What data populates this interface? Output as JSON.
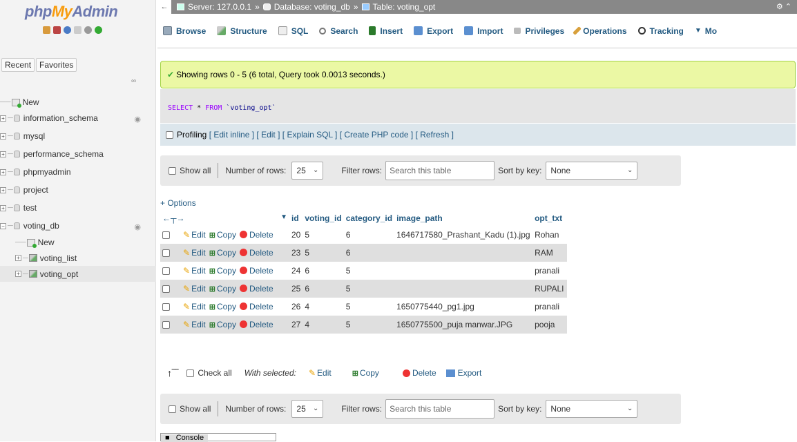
{
  "sidebar": {
    "logo_php": "php",
    "logo_my": "My",
    "logo_admin": "Admin",
    "tab_recent": "Recent",
    "tab_favorites": "Favorites",
    "tree": [
      {
        "label": "New"
      },
      {
        "label": "information_schema"
      },
      {
        "label": "mysql"
      },
      {
        "label": "performance_schema"
      },
      {
        "label": "phpmyadmin"
      },
      {
        "label": "project"
      },
      {
        "label": "test"
      },
      {
        "label": "voting_db"
      },
      {
        "label": "New"
      },
      {
        "label": "voting_list"
      },
      {
        "label": "voting_opt"
      }
    ]
  },
  "topbar": {
    "server": "Server: 127.0.0.1",
    "database": "Database: voting_db",
    "table": "Table: voting_opt",
    "sep": "»"
  },
  "tabs": [
    {
      "label": "Browse"
    },
    {
      "label": "Structure"
    },
    {
      "label": "SQL"
    },
    {
      "label": "Search"
    },
    {
      "label": "Insert"
    },
    {
      "label": "Export"
    },
    {
      "label": "Import"
    },
    {
      "label": "Privileges"
    },
    {
      "label": "Operations"
    },
    {
      "label": "Tracking"
    },
    {
      "label": "Mo"
    }
  ],
  "success_message": "Showing rows 0 - 5 (6 total, Query took 0.0013 seconds.)",
  "sql": {
    "kw1": "SELECT",
    "star": " * ",
    "kw2": "FROM",
    "table": " `voting_opt`"
  },
  "profiling": {
    "label": "Profiling",
    "links": [
      "Edit inline",
      "Edit",
      "Explain SQL",
      "Create PHP code",
      "Refresh"
    ]
  },
  "nav": {
    "show_all": "Show all",
    "rows_label": "Number of rows:",
    "rows_value": "25",
    "filter_label": "Filter rows:",
    "filter_placeholder": "Search this table",
    "sort_label": "Sort by key:",
    "sort_value": "None"
  },
  "options_link": "+ Options",
  "grid": {
    "headers": [
      "id",
      "voting_id",
      "category_id",
      "image_path",
      "opt_txt"
    ],
    "action_labels": {
      "edit": "Edit",
      "copy": "Copy",
      "delete": "Delete"
    },
    "rows": [
      {
        "id": "20",
        "voting_id": "5",
        "category_id": "6",
        "image_path": "1646717580_Prashant_Kadu (1).jpg",
        "opt_txt": "Rohan"
      },
      {
        "id": "23",
        "voting_id": "5",
        "category_id": "6",
        "image_path": "",
        "opt_txt": "RAM"
      },
      {
        "id": "24",
        "voting_id": "6",
        "category_id": "5",
        "image_path": "",
        "opt_txt": "pranali"
      },
      {
        "id": "25",
        "voting_id": "6",
        "category_id": "5",
        "image_path": "",
        "opt_txt": "RUPALI"
      },
      {
        "id": "26",
        "voting_id": "4",
        "category_id": "5",
        "image_path": "1650775440_pg1.jpg",
        "opt_txt": "pranali"
      },
      {
        "id": "27",
        "voting_id": "4",
        "category_id": "5",
        "image_path": "1650775500_puja manwar.JPG",
        "opt_txt": "pooja"
      }
    ]
  },
  "bulk": {
    "check_all": "Check all",
    "with_selected": "With selected:",
    "edit": "Edit",
    "copy": "Copy",
    "delete": "Delete",
    "export": "Export"
  },
  "console_label": "Console",
  "colors": {
    "link": "#235a81",
    "success_bg": "#ebf8a4",
    "topbar": "#888888"
  }
}
